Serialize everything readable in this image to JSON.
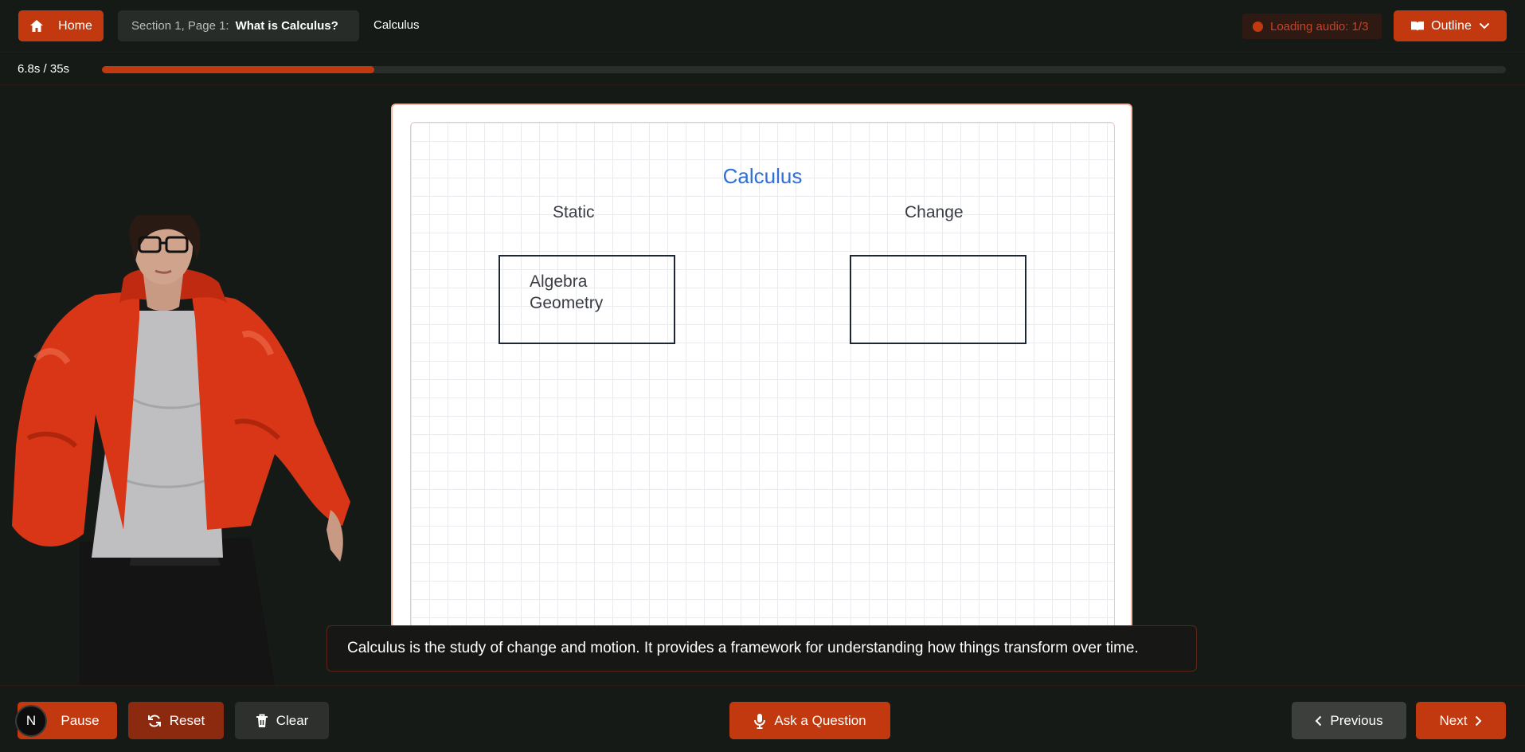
{
  "header": {
    "home_label": "Home",
    "breadcrumb_section": "Section 1, Page 1:",
    "breadcrumb_page": "What is Calculus?",
    "topic": "Calculus",
    "loading_label": "Loading audio: 1/3",
    "outline_label": "Outline"
  },
  "progress": {
    "time_text": "6.8s / 35s",
    "fraction": 0.194
  },
  "avatar": {
    "icon": "3d-character-avatar"
  },
  "whiteboard": {
    "title": "Calculus",
    "left_label": "Static",
    "right_label": "Change",
    "left_box_lines": [
      "Algebra",
      "Geometry"
    ],
    "right_box_lines": []
  },
  "caption": {
    "text": "Calculus is the study of change and motion. It provides a framework for understanding how things transform over time."
  },
  "controls": {
    "badge_letter": "N",
    "pause_label": "Pause",
    "reset_label": "Reset",
    "clear_label": "Clear",
    "ask_label": "Ask a Question",
    "previous_label": "Previous",
    "next_label": "Next"
  },
  "colors": {
    "accent": "#c2390f",
    "background": "#161a16",
    "title_blue": "#2f6fd6"
  }
}
